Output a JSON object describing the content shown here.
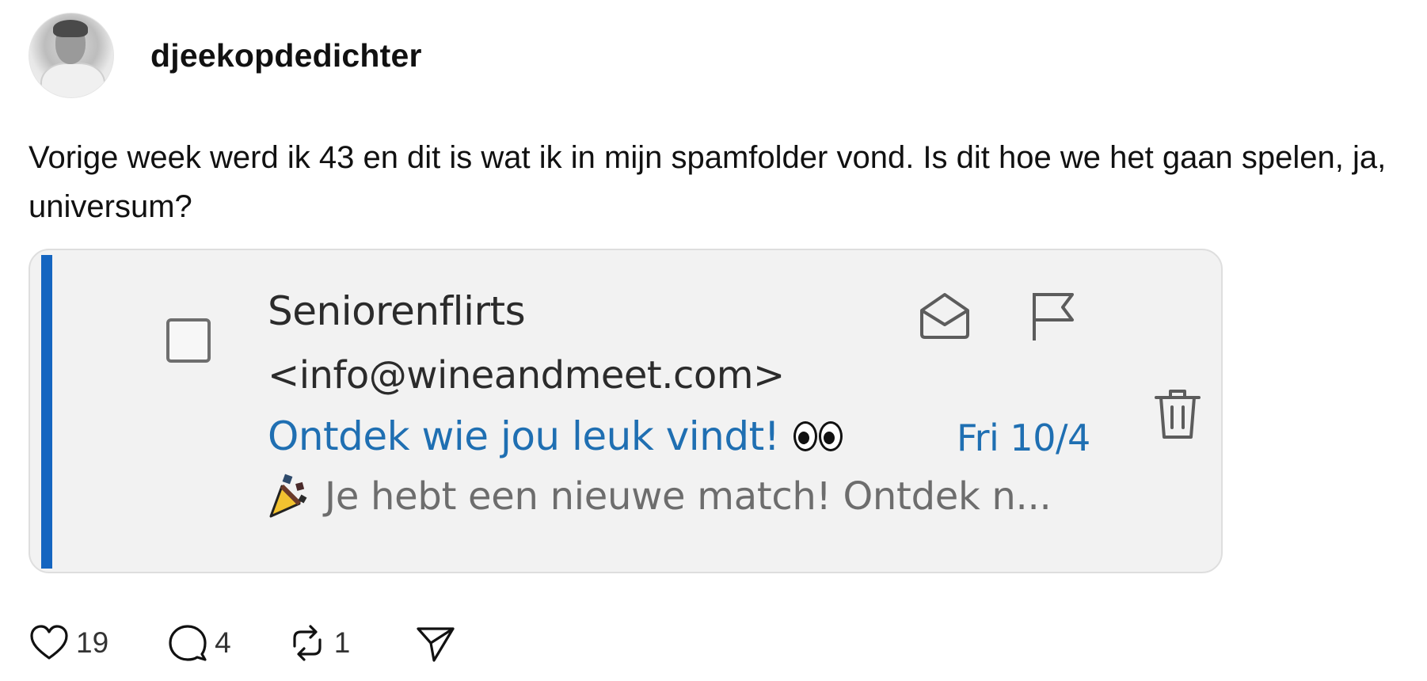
{
  "post": {
    "username": "djeekopdedichter",
    "text": "Vorige week werd ik 43 en dit is wat ik in mijn spamfolder vond. Is dit hoe we het gaan spelen, ja, universum?"
  },
  "email": {
    "sender": "Seniorenflirts",
    "sender_email": "<info@wineandmeet.com>",
    "subject": "Ontdek wie jou leuk vindt!",
    "date": "Fri 10/4",
    "preview": "Je hebt een nieuwe match! Ontdek n...",
    "subject_emoji": "eyes-icon",
    "preview_emoji": "party-popper-icon",
    "accent_color": "#1565c0",
    "subject_color": "#1f6fb2"
  },
  "actions": {
    "likes": "19",
    "replies": "4",
    "reposts": "1"
  }
}
